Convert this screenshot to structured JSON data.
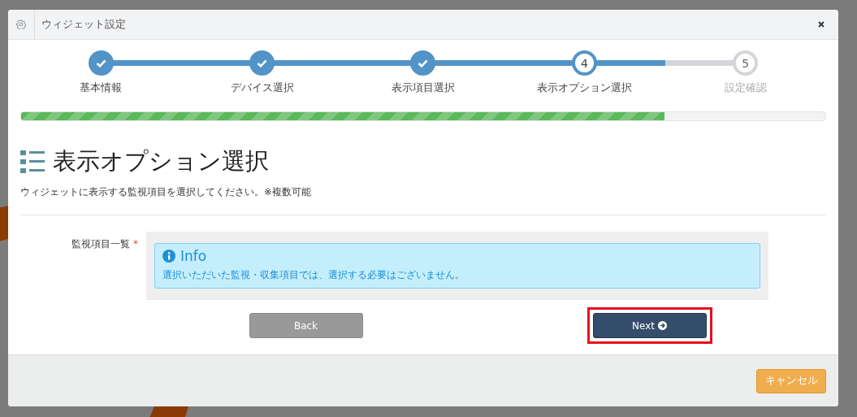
{
  "window": {
    "title": "ウィジェット設定"
  },
  "steps": [
    {
      "label": "基本情報",
      "completed": true,
      "active": false
    },
    {
      "label": "デバイス選択",
      "completed": true,
      "active": false
    },
    {
      "label": "表示項目選択",
      "completed": true,
      "active": false
    },
    {
      "number": "4",
      "label": "表示オプション選択",
      "completed": false,
      "active": true
    },
    {
      "number": "5",
      "label": "設定確認",
      "completed": false,
      "active": false
    }
  ],
  "progress": {
    "level": 0.8
  },
  "heading": "表示オプション選択",
  "description": "ウィジェットに表示する監視項目を選択してください。※複数可能",
  "form": {
    "label": "監視項目一覧",
    "required_mark": "*",
    "info": {
      "title": "Info",
      "message": "選択いただいた監視・収集項目では、選択する必要はございません。"
    }
  },
  "buttons": [
    {
      "label": "Back",
      "kind": "back",
      "highlighted": false
    },
    {
      "label": "Next",
      "kind": "next",
      "highlighted": true
    }
  ],
  "footer": {
    "cancel": "キャンセル"
  }
}
